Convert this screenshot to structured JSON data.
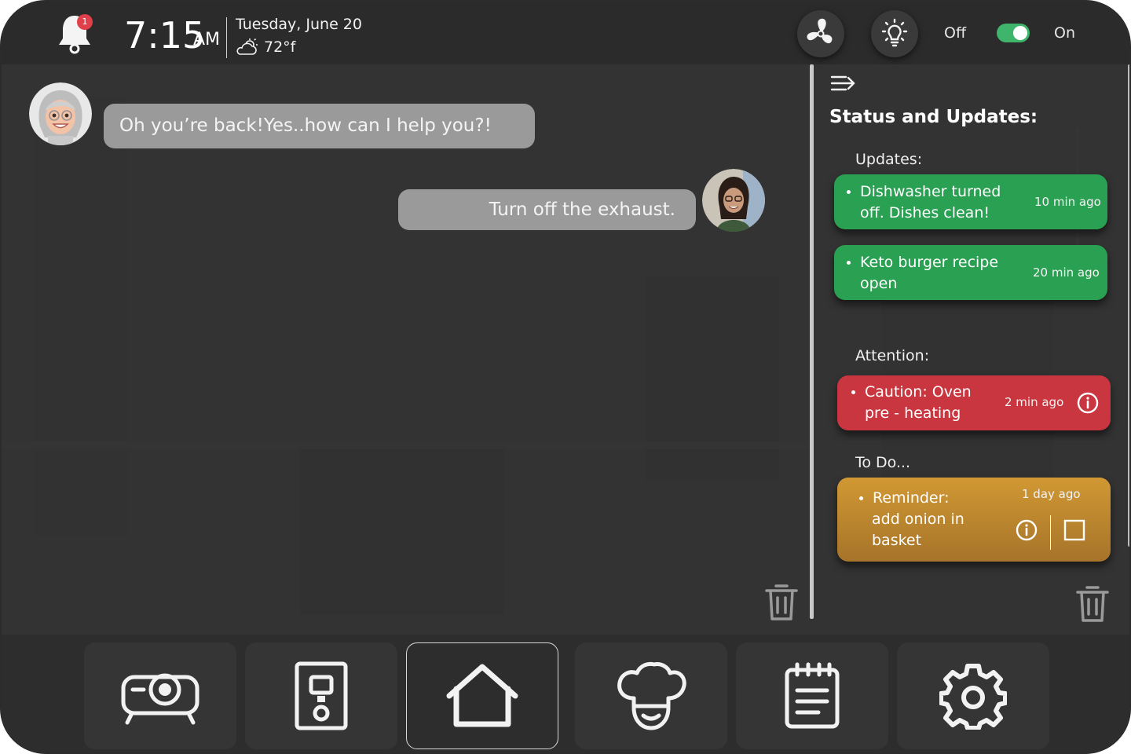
{
  "header": {
    "notification_count": "1",
    "time": "7:15",
    "ampm": "AM",
    "date": "Tuesday, June 20",
    "temperature": "72°f",
    "weather_icon": "partly-cloudy-icon",
    "fan_icon": "fan-icon",
    "light_icon": "lightbulb-icon",
    "toggle_off_label": "Off",
    "toggle_on_label": "On",
    "toggle_state": "on",
    "toggle_color": "#3fb56b"
  },
  "chat": {
    "messages": [
      {
        "sender": "assistant",
        "avatar_icon": "assistant-avatar",
        "text": "Oh you’re back!Yes..how can I help you?!"
      },
      {
        "sender": "user",
        "avatar_icon": "user-avatar",
        "text": "Turn off the exhaust."
      }
    ]
  },
  "panel": {
    "collapse_icon": "collapse-panel-icon",
    "title": "Status and Updates:",
    "updates_label": "Updates:",
    "updates": [
      {
        "line1": "Dishwasher turned",
        "line2": "off. Dishes clean!",
        "time": "10 min ago",
        "color": "#2aa052"
      },
      {
        "line1": "Keto burger recipe",
        "line2": "open",
        "time": "20 min ago",
        "color": "#2aa052"
      }
    ],
    "attention_label": "Attention:",
    "attention": [
      {
        "line1": "Caution: Oven",
        "line2": "pre - heating",
        "time": "2 min ago",
        "color": "#c9363f"
      }
    ],
    "todo_label": "To Do...",
    "todo": [
      {
        "line1": "Reminder:",
        "line2": "add onion in",
        "line3": "basket",
        "time": "1 day ago",
        "color": "#c28a2c"
      }
    ]
  },
  "nav": {
    "items": [
      {
        "name": "projector",
        "icon": "projector-icon"
      },
      {
        "name": "appliance",
        "icon": "appliance-icon"
      },
      {
        "name": "home",
        "icon": "home-icon",
        "active": true
      },
      {
        "name": "chef",
        "icon": "chef-hat-icon"
      },
      {
        "name": "notes",
        "icon": "notepad-icon"
      },
      {
        "name": "settings",
        "icon": "gear-icon"
      }
    ]
  }
}
